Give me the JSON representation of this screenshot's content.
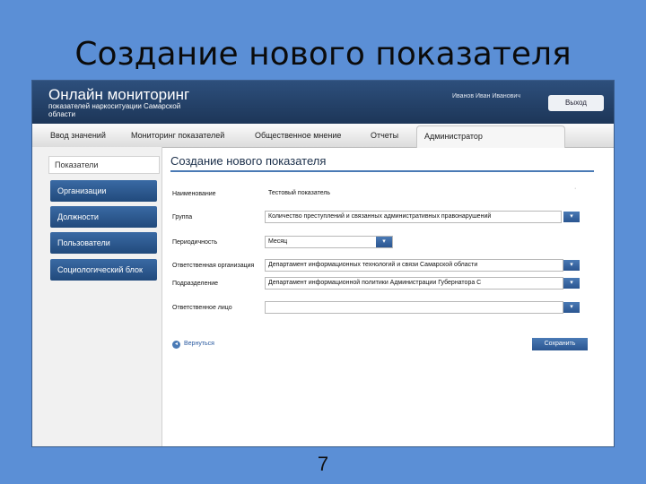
{
  "slide": {
    "title": "Создание нового показателя",
    "page_number": "7"
  },
  "header": {
    "brand": "Онлайн мониторинг",
    "subtitle": "показателей наркоситуации Самарской области",
    "user": "Иванов Иван Иванович",
    "logout": "Выход"
  },
  "nav": {
    "tabs": [
      {
        "label": "Ввод значений"
      },
      {
        "label": "Мониторинг показателей"
      },
      {
        "label": "Общественное мнение"
      },
      {
        "label": "Отчеты"
      },
      {
        "label": "Администратор",
        "active": true
      }
    ]
  },
  "sidebar": {
    "header": "Показатели",
    "items": [
      {
        "label": "Организации"
      },
      {
        "label": "Должности"
      },
      {
        "label": "Пользователи"
      },
      {
        "label": "Социологический блок"
      }
    ]
  },
  "form": {
    "title": "Создание нового показателя",
    "fields": [
      {
        "label": "Наименование",
        "value": "Тестовый показатель"
      },
      {
        "label": "Группа",
        "value": "Количество преступлений и связанных административных правонарушений"
      },
      {
        "label": "Периодичность",
        "value": "Месяц"
      },
      {
        "label": "Ответственная организация",
        "value": "Департамент информационных технологий и связи Самарской области"
      },
      {
        "label": "Подразделение",
        "value": "Департамент информационной политики Администрации Губернатора С"
      },
      {
        "label": "Ответственное лицо",
        "value": ""
      }
    ],
    "back": "Вернуться",
    "save": "Сохранить"
  },
  "icons": {
    "dropdown": "chevron-down-icon",
    "back": "back-arrow-icon"
  },
  "colors": {
    "slide_bg": "#5b8fd6",
    "header_bg": "#1d3658",
    "button_blue": "#2a5590"
  }
}
